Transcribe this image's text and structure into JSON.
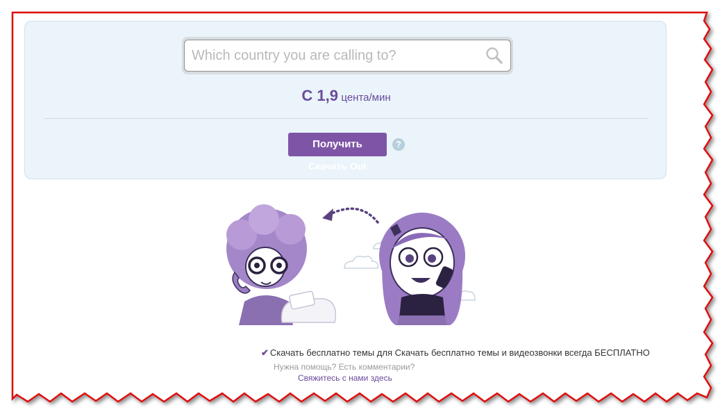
{
  "search": {
    "placeholder": "Which country you are calling to?"
  },
  "rate": {
    "amount": "С 1,9",
    "unit": "цента/мин"
  },
  "buttons": {
    "get_label": "Получить",
    "help_label": "?",
    "download_out_label": "Скачать Out"
  },
  "footer": {
    "free_text": "Скачать бесплатно темы для Скачать бесплатно темы и видеозвонки всегда БЕСПЛАТНО",
    "help_text": "Нужна помощь? Есть комментарии?",
    "contact_link": "Свяжитесь с нами здесь"
  },
  "colors": {
    "accent": "#7e55a6",
    "panel_bg": "#eaf4fa",
    "frame": "#e01010"
  },
  "icons": [
    "search-icon",
    "question-icon",
    "checkmark-icon",
    "arrow-icon",
    "cloud-icon",
    "phone-icon"
  ]
}
